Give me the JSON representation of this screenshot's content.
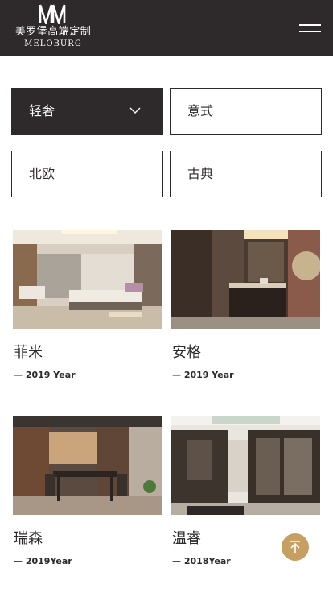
{
  "header": {
    "logo_mark": "MM",
    "brand_cn": "美罗堡高端定制",
    "brand_en": "MELOBURG",
    "menu_icon": "hamburger-menu-icon"
  },
  "filters": [
    {
      "label": "轻奢",
      "active": true,
      "icon": "chevron-down-icon"
    },
    {
      "label": "意式",
      "active": false
    },
    {
      "label": "北欧",
      "active": false
    },
    {
      "label": "古典",
      "active": false
    }
  ],
  "products": [
    {
      "title": "菲米",
      "year": "— 2019 Year",
      "image": "bedroom-photo"
    },
    {
      "title": "安格",
      "year": "— 2019 Year",
      "image": "kitchen-island-photo"
    },
    {
      "title": "瑞森",
      "year": "— 2019Year",
      "image": "dining-room-photo"
    },
    {
      "title": "温睿",
      "year": "— 2018Year",
      "image": "wardrobe-photo"
    }
  ],
  "back_to_top_icon": "arrow-up-icon",
  "colors": {
    "header_bg": "#2e2a2b",
    "accent": "#c89f62",
    "text": "#2e2a2b"
  }
}
